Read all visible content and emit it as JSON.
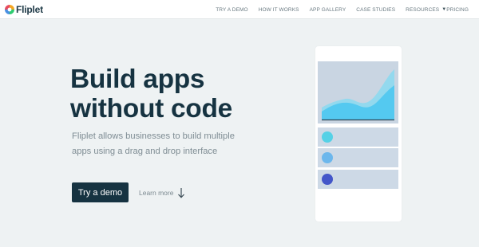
{
  "brand": {
    "name": "Fliplet",
    "logo_colors": [
      "#f5a623",
      "#e84a5f",
      "#4a90e2",
      "#2ecc71"
    ]
  },
  "nav": {
    "links": [
      "TRY A DEMO",
      "HOW IT WORKS",
      "APP GALLERY",
      "CASE STUDIES"
    ],
    "resources": "RESOURCES",
    "pricing": "PRICING"
  },
  "hero": {
    "title_line1": "Build apps",
    "title_line2": "without code",
    "subtitle": "Fliplet allows businesses to build multiple apps using a drag and drop interface",
    "cta_label": "Try a demo",
    "learn_more_label": "Learn more"
  },
  "mockup": {
    "row_colors": [
      "#55d1e6",
      "#6cb7ec",
      "#4356c9"
    ]
  },
  "colors": {
    "dark": "#163341",
    "background": "#eef2f3",
    "text_muted": "#7f8d94"
  }
}
